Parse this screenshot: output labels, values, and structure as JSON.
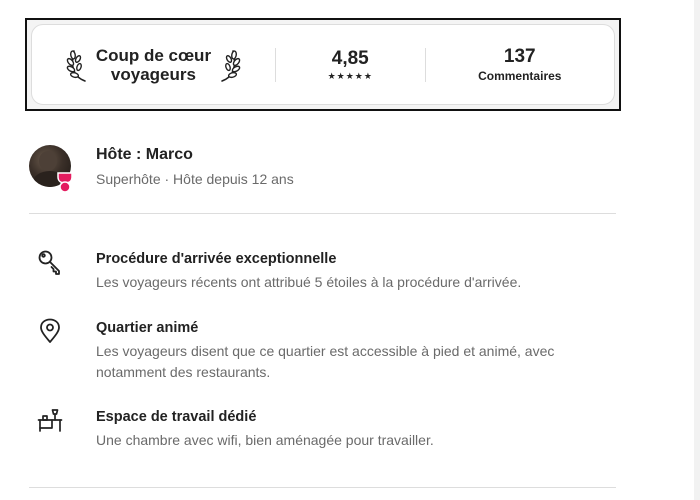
{
  "guest_favorite": {
    "badge_label": "Coup de cœur\nvoyageurs",
    "rating_value": "4,85",
    "rating_stars": "★★★★★",
    "reviews_count": "137",
    "reviews_label": "Commentaires"
  },
  "host": {
    "title": "Hôte : Marco",
    "subtitle": "Superhôte · Hôte depuis 12 ans"
  },
  "highlights": [
    {
      "icon": "key-icon",
      "title": "Procédure d'arrivée exceptionnelle",
      "description": "Les voyageurs récents ont attribué 5 étoiles à la procédure d'arrivée."
    },
    {
      "icon": "location-pin-icon",
      "title": "Quartier animé",
      "description": "Les voyageurs disent que ce quartier est accessible à pied et animé, avec notamment des restaurants."
    },
    {
      "icon": "desk-icon",
      "title": "Espace de travail dédié",
      "description": "Une chambre avec wifi, bien aménagée pour travailler."
    }
  ],
  "colors": {
    "superhost_badge": "#e31c5f",
    "text_primary": "#222222",
    "text_secondary": "#6a6a6a",
    "divider": "#dddddd"
  }
}
